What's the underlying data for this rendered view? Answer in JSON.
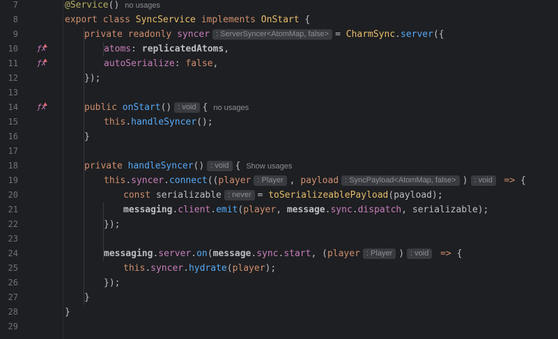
{
  "editor": {
    "line_numbers": [
      "7",
      "8",
      "9",
      "10",
      "11",
      "12",
      "13",
      "14",
      "15",
      "16",
      "17",
      "18",
      "19",
      "20",
      "21",
      "22",
      "23",
      "24",
      "25",
      "26",
      "27",
      "28",
      "29"
    ],
    "tokens": {
      "service_decorator": "@Service",
      "decorator_parens": "()",
      "no_usages_1": "no usages",
      "export": "export",
      "class": "class",
      "class_name": "SyncService",
      "implements": "implements",
      "interface_name": "OnStart",
      "open_brace": "{",
      "private": "private",
      "readonly": "readonly",
      "syncer": "syncer",
      "syncer_type_hint": ": ServerSyncer<AtomMap, false>",
      "equals": "=",
      "charm_sync": "CharmSync",
      "dot": ".",
      "server_fn": "server",
      "open_call": "({",
      "atoms_key": "atoms",
      "colon": ":",
      "replicated_atoms": "replicatedAtoms",
      "comma": ",",
      "auto_serialize_key": "autoSerialize",
      "false_value": "false",
      "close_call": "});",
      "public": "public",
      "on_start": "onStart",
      "parens": "()",
      "void_hint": ": void",
      "no_usages_2": "no usages",
      "this": "this",
      "handle_syncer": "handleSyncer",
      "call_end": "();",
      "close_brace": "}",
      "show_usages": "Show usages",
      "connect": "connect",
      "open_paren2": "((",
      "player": "player",
      "player_hint": ": Player",
      "payload": "payload",
      "payload_hint": ": SyncPayload<AtomMap, false>",
      "close_paren": ")",
      "arrow": "=>",
      "const": "const",
      "serializable": "serializable",
      "never_hint": ": never",
      "to_serializeable_payload": "toSerializeablePayload",
      "paren_payload": "(payload);",
      "messaging": "messaging",
      "client": "client",
      "emit": "emit",
      "open_paren": "(",
      "message": "message",
      "sync": "sync",
      "dispatch": "dispatch",
      "serializable_end": "serializable);",
      "close_paren_semi": "});",
      "server_prop": "server",
      "on": "on",
      "start": "start",
      "hydrate": "hydrate",
      "player_end": "player",
      "end_paren_semi": ");"
    }
  },
  "colors": {
    "background": "#1e1f22",
    "keyword": "#cf8e6d",
    "function": "#56a8f5",
    "class": "#e8be6b",
    "annotation": "#b3ae60",
    "property": "#c77dba",
    "hint_bg": "#393b40"
  },
  "gutter_icons": [
    "override-function-icon",
    "override-function-icon",
    "override-function-icon"
  ]
}
